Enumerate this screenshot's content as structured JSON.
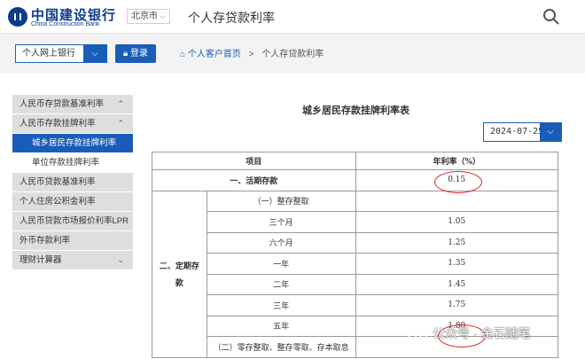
{
  "header": {
    "brand_cn": "中国建设银行",
    "brand_en": "China Construction Bank",
    "city": "北京市",
    "page_heading": "个人存贷款利率"
  },
  "toolbar": {
    "bank_select": "个人网上银行",
    "login_label": "登录",
    "breadcrumb": [
      "个人客户首页",
      ">",
      "个人存贷款利率"
    ]
  },
  "sidebar": {
    "items": [
      {
        "label": "人民币存贷款基准利率",
        "type": "group",
        "chev": "⌃"
      },
      {
        "label": "人民币存款挂牌利率",
        "type": "group",
        "chev": "⌃"
      },
      {
        "label": "城乡居民存款挂牌利率",
        "type": "active"
      },
      {
        "label": "单位存款挂牌利率",
        "type": "sub"
      },
      {
        "label": "人民币贷款基准利率",
        "type": "group"
      },
      {
        "label": "个人住房公积金利率",
        "type": "group"
      },
      {
        "label": "人民币贷款市场报价利率LPR",
        "type": "group"
      },
      {
        "label": "外币存款利率",
        "type": "group"
      },
      {
        "label": "理财计算器",
        "type": "group",
        "chev": "⌄"
      }
    ]
  },
  "main": {
    "table_title": "城乡居民存款挂牌利率表",
    "date_value": "2024-07-25",
    "col_item": "项目",
    "col_rate": "年利率（%）",
    "demand_label": "一、活期存款",
    "demand_rate": "0.15",
    "fixed_label_1": "二、定期存",
    "fixed_label_2": "款",
    "lump_label": "（一）整存整取",
    "rows": [
      {
        "term": "三个月",
        "rate": "1.05"
      },
      {
        "term": "六个月",
        "rate": "1.25"
      },
      {
        "term": "一年",
        "rate": "1.35"
      },
      {
        "term": "二年",
        "rate": "1.45"
      },
      {
        "term": "三年",
        "rate": "1.75"
      },
      {
        "term": "五年",
        "rate": "1.80"
      }
    ],
    "next_label": "（二）零存整取、整存零取、存本取息"
  },
  "watermark": "公众号 · 金石随笔",
  "colors": {
    "accent": "#1a5db8",
    "brand": "#0b3c8c",
    "highlight": "#e02020"
  }
}
